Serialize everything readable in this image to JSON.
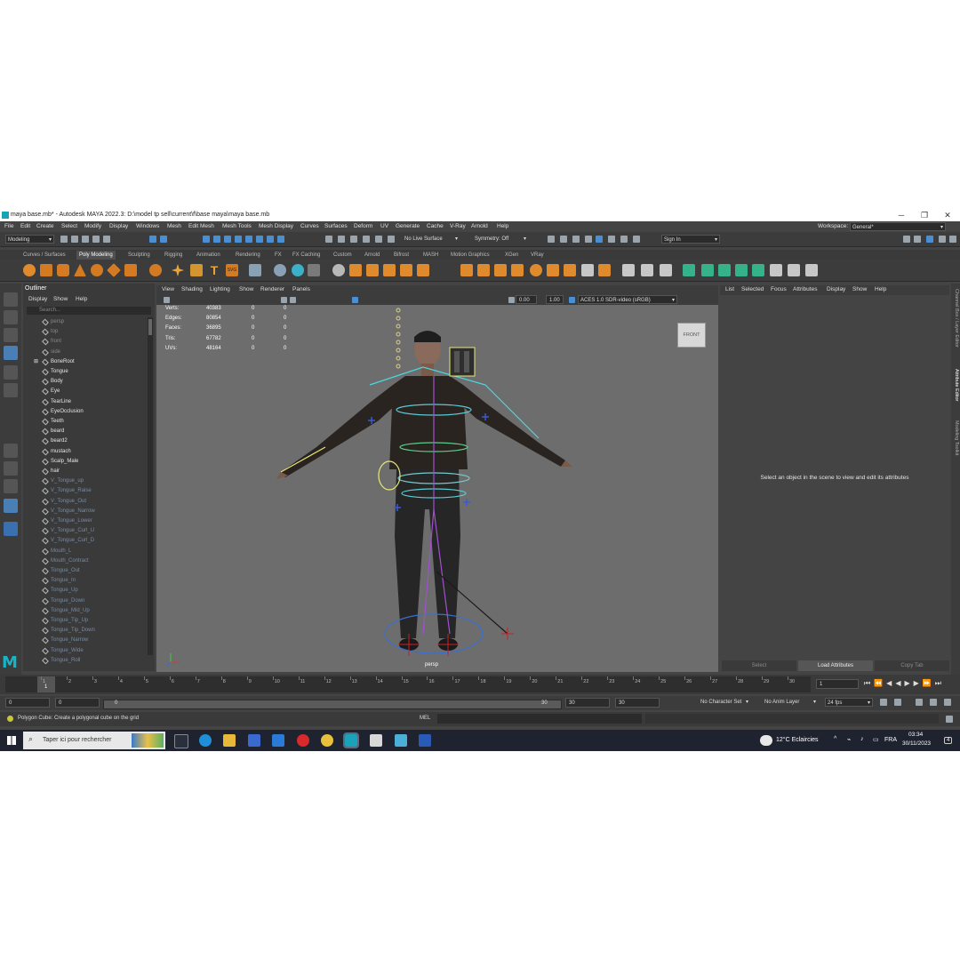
{
  "window": {
    "title": "maya base.mb* - Autodesk MAYA 2022.3: D:\\model tp sell\\current\\f\\base maya\\maya base.mb",
    "controls": [
      "─",
      "❐",
      "✕"
    ]
  },
  "menubar": {
    "items": [
      "File",
      "Edit",
      "Create",
      "Select",
      "Modify",
      "Display",
      "Windows",
      "Mesh",
      "Edit Mesh",
      "Mesh Tools",
      "Mesh Display",
      "Curves",
      "Surfaces",
      "Deform",
      "UV",
      "Generate",
      "Cache",
      "V-Ray",
      "Arnold",
      "Help"
    ],
    "workspace_label": "Workspace:",
    "workspace_value": "General*"
  },
  "statusline": {
    "menuset": "Modeling",
    "live_surface": "No Live Surface",
    "symmetry": "Symmetry: Off",
    "sign_in": "Sign In"
  },
  "shelf": {
    "tabs": [
      "Curves / Surfaces",
      "Poly Modeling",
      "Sculpting",
      "Rigging",
      "Animation",
      "Rendering",
      "FX",
      "FX Caching",
      "Custom",
      "Arnold",
      "Bifrost",
      "MASH",
      "Motion Graphics",
      "XGen",
      "VRay"
    ],
    "active_tab": "Poly Modeling"
  },
  "outliner": {
    "title": "Outliner",
    "menu": [
      "Display",
      "Show",
      "Help"
    ],
    "search_placeholder": "Search...",
    "items": [
      {
        "label": "persp",
        "style": "dim"
      },
      {
        "label": "top",
        "style": "dim"
      },
      {
        "label": "front",
        "style": "dim"
      },
      {
        "label": "side",
        "style": "dim"
      },
      {
        "label": "BoneRoot",
        "style": "bright"
      },
      {
        "label": "Tongue",
        "style": "bright"
      },
      {
        "label": "Body",
        "style": "bright"
      },
      {
        "label": "Eye",
        "style": "bright"
      },
      {
        "label": "TearLine",
        "style": "bright"
      },
      {
        "label": "EyeOcclusion",
        "style": "bright"
      },
      {
        "label": "Teeth",
        "style": "bright"
      },
      {
        "label": "beard",
        "style": "bright"
      },
      {
        "label": "beard2",
        "style": "bright"
      },
      {
        "label": "mustach",
        "style": "bright"
      },
      {
        "label": "Scalp_Male",
        "style": "bright"
      },
      {
        "label": "hair",
        "style": "bright"
      },
      {
        "label": "V_Tongue_up",
        "style": "blend"
      },
      {
        "label": "V_Tongue_Raise",
        "style": "blend"
      },
      {
        "label": "V_Tongue_Out",
        "style": "blend"
      },
      {
        "label": "V_Tongue_Narrow",
        "style": "blend"
      },
      {
        "label": "V_Tongue_Lower",
        "style": "blend"
      },
      {
        "label": "V_Tongue_Curl_U",
        "style": "blend"
      },
      {
        "label": "V_Tongue_Curl_D",
        "style": "blend"
      },
      {
        "label": "Mouth_L",
        "style": "blend"
      },
      {
        "label": "Mouth_Contract",
        "style": "blend"
      },
      {
        "label": "Tongue_Out",
        "style": "blend"
      },
      {
        "label": "Tongue_In",
        "style": "blend"
      },
      {
        "label": "Tongue_Up",
        "style": "blend"
      },
      {
        "label": "Tongue_Down",
        "style": "blend"
      },
      {
        "label": "Tongue_Mid_Up",
        "style": "blend"
      },
      {
        "label": "Tongue_Tip_Up",
        "style": "blend"
      },
      {
        "label": "Tongue_Tip_Down",
        "style": "blend"
      },
      {
        "label": "Tongue_Narrow",
        "style": "blend"
      },
      {
        "label": "Tongue_Wide",
        "style": "blend"
      },
      {
        "label": "Tongue_Roll",
        "style": "blend"
      }
    ]
  },
  "viewport": {
    "menu": [
      "View",
      "Shading",
      "Lighting",
      "Show",
      "Renderer",
      "Panels"
    ],
    "exposure": "0.00",
    "gamma": "1.00",
    "color_space": "ACES 1.0 SDR-video (sRGB)",
    "hud": [
      {
        "label": "Verts:",
        "a": "40383",
        "b": "0",
        "c": "0"
      },
      {
        "label": "Edges:",
        "a": "80854",
        "b": "0",
        "c": "0"
      },
      {
        "label": "Faces:",
        "a": "36895",
        "b": "0",
        "c": "0"
      },
      {
        "label": "Tris:",
        "a": "67782",
        "b": "0",
        "c": "0"
      },
      {
        "label": "UVs:",
        "a": "48164",
        "b": "0",
        "c": "0"
      }
    ],
    "camera": "persp",
    "viewcube": "FRONT"
  },
  "attribute_editor": {
    "menu": [
      "List",
      "Selected",
      "Focus",
      "Attributes",
      "Display",
      "Show",
      "Help"
    ],
    "message": "Select an object in the scene to view and edit its attributes",
    "buttons": [
      "Select",
      "Load Attributes",
      "Copy Tab"
    ],
    "side_tabs": [
      "Channel Box / Layer Editor",
      "Attribute Editor",
      "Modeling Toolkit"
    ]
  },
  "timeline": {
    "ticks": [
      "1",
      "2",
      "3",
      "4",
      "5",
      "6",
      "7",
      "8",
      "9",
      "10",
      "11",
      "12",
      "13",
      "14",
      "15",
      "16",
      "17",
      "18",
      "19",
      "20",
      "21",
      "22",
      "23",
      "24",
      "25",
      "26",
      "27",
      "28",
      "29",
      "30"
    ],
    "current_frame": "1",
    "current_display": "1"
  },
  "range": {
    "start": "0",
    "anim_start": "0",
    "slider_start": "0",
    "slider_end": "30",
    "end": "30",
    "anim_end": "30",
    "character_set": "No Character Set",
    "anim_layer": "No Anim Layer",
    "fps": "24 fps"
  },
  "command": {
    "help_text": "Polygon Cube: Create a polygonal cube on the grid",
    "mel_label": "MEL"
  },
  "taskbar": {
    "search_placeholder": "Taper ici pour rechercher",
    "weather": "12°C  Eclaircies",
    "language": "FRA",
    "time": "03:34",
    "date": "30/11/2023",
    "notifications": "4"
  }
}
